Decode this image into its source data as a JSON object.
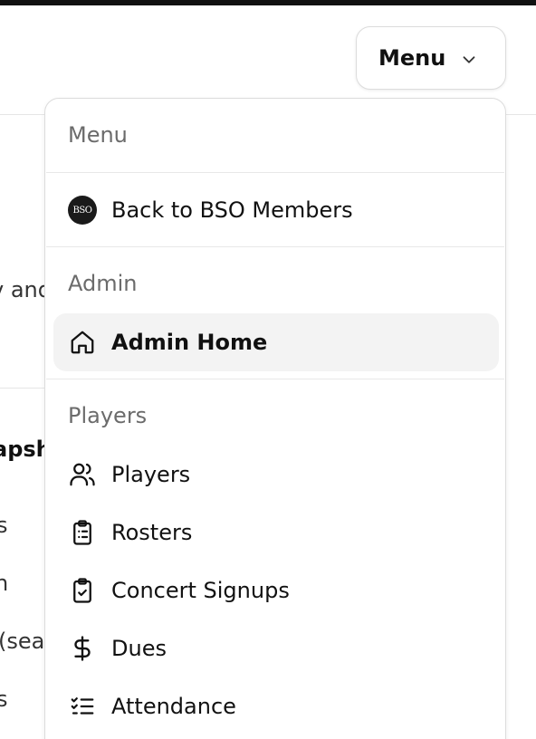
{
  "header": {
    "menu_button_label": "Menu"
  },
  "background": {
    "fragment_1": "v and",
    "fragment_2": "apsh",
    "fragment_3": "s",
    "fragment_4": "n",
    "fragment_5": "(sea",
    "fragment_6": "s"
  },
  "dropdown": {
    "title": "Menu",
    "back_item": {
      "label": "Back to BSO Members",
      "logo_text": "BSO",
      "icon": "bso-logo-icon"
    },
    "admin_section": {
      "label": "Admin",
      "items": [
        {
          "label": "Admin Home",
          "icon": "home-icon",
          "active": true
        }
      ]
    },
    "players_section": {
      "label": "Players",
      "items": [
        {
          "label": "Players",
          "icon": "users-icon"
        },
        {
          "label": "Rosters",
          "icon": "clipboard-list-icon"
        },
        {
          "label": "Concert Signups",
          "icon": "clipboard-check-icon"
        },
        {
          "label": "Dues",
          "icon": "dollar-icon"
        },
        {
          "label": "Attendance",
          "icon": "list-checks-icon"
        }
      ]
    }
  }
}
